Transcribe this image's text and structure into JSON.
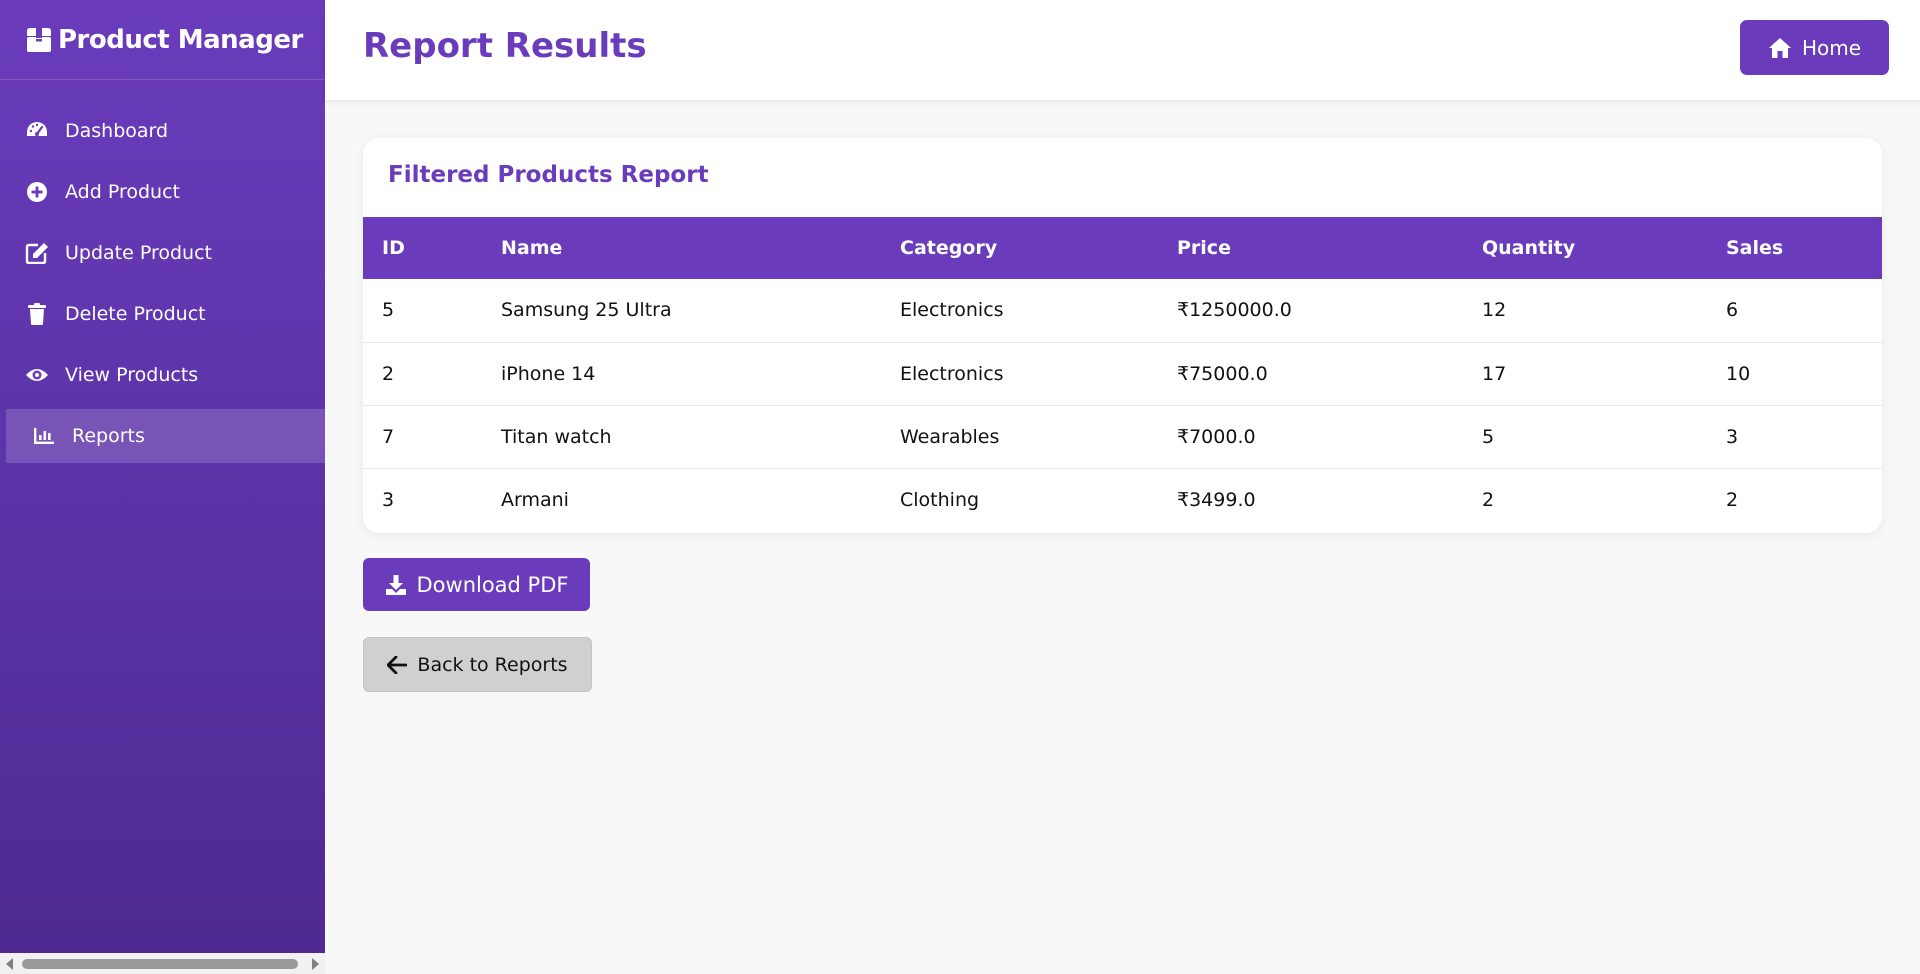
{
  "sidebar": {
    "brand": "Product Manager",
    "items": [
      {
        "label": "Dashboard",
        "icon": "speedometer-icon"
      },
      {
        "label": "Add Product",
        "icon": "plus-circle-icon"
      },
      {
        "label": "Update Product",
        "icon": "edit-icon"
      },
      {
        "label": "Delete Product",
        "icon": "trash-icon"
      },
      {
        "label": "View Products",
        "icon": "eye-icon"
      },
      {
        "label": "Reports",
        "icon": "bar-chart-icon",
        "active": true
      }
    ]
  },
  "header": {
    "title": "Report Results",
    "home_label": "Home"
  },
  "report": {
    "title": "Filtered Products Report",
    "columns": [
      "ID",
      "Name",
      "Category",
      "Price",
      "Quantity",
      "Sales"
    ],
    "rows": [
      [
        "5",
        "Samsung 25 Ultra",
        "Electronics",
        "₹1250000.0",
        "12",
        "6"
      ],
      [
        "2",
        "iPhone 14",
        "Electronics",
        "₹75000.0",
        "17",
        "10"
      ],
      [
        "7",
        "Titan watch",
        "Wearables",
        "₹7000.0",
        "5",
        "3"
      ],
      [
        "3",
        "Armani",
        "Clothing",
        "₹3499.0",
        "2",
        "2"
      ]
    ]
  },
  "actions": {
    "download_label": "Download PDF",
    "back_label": "Back to Reports"
  },
  "colors": {
    "accent": "#6a3cbc",
    "sidebar_bottom": "#4e2a92",
    "back_button": "#d0d0d0"
  }
}
